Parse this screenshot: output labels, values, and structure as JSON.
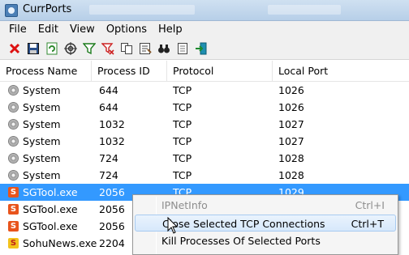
{
  "window": {
    "title": "CurrPorts"
  },
  "menu": [
    "File",
    "Edit",
    "View",
    "Options",
    "Help"
  ],
  "toolbar": [
    "close-connection-icon",
    "save-icon",
    "refresh-icon",
    "target-icon",
    "filter-icon",
    "clear-filter-icon",
    "copy-icon",
    "properties-icon",
    "find-icon",
    "report-icon",
    "exit-icon"
  ],
  "columns": [
    "Process Name",
    "Process ID",
    "Protocol",
    "Local Port"
  ],
  "rows": [
    {
      "icon": "gear",
      "name": "System",
      "pid": "644",
      "protocol": "TCP",
      "port": "1026",
      "selected": false
    },
    {
      "icon": "gear",
      "name": "System",
      "pid": "644",
      "protocol": "TCP",
      "port": "1026",
      "selected": false
    },
    {
      "icon": "gear",
      "name": "System",
      "pid": "1032",
      "protocol": "TCP",
      "port": "1027",
      "selected": false
    },
    {
      "icon": "gear",
      "name": "System",
      "pid": "1032",
      "protocol": "TCP",
      "port": "1027",
      "selected": false
    },
    {
      "icon": "gear",
      "name": "System",
      "pid": "724",
      "protocol": "TCP",
      "port": "1028",
      "selected": false
    },
    {
      "icon": "gear",
      "name": "System",
      "pid": "724",
      "protocol": "TCP",
      "port": "1028",
      "selected": false
    },
    {
      "icon": "sgtool",
      "name": "SGTool.exe",
      "pid": "2056",
      "protocol": "TCP",
      "port": "1029",
      "selected": true
    },
    {
      "icon": "sgtool",
      "name": "SGTool.exe",
      "pid": "2056",
      "protocol": "",
      "port": "",
      "selected": false
    },
    {
      "icon": "sgtool",
      "name": "SGTool.exe",
      "pid": "2056",
      "protocol": "",
      "port": "",
      "selected": false
    },
    {
      "icon": "sohu",
      "name": "SohuNews.exe",
      "pid": "2204",
      "protocol": "",
      "port": "",
      "selected": false
    }
  ],
  "context_menu": [
    {
      "label": "IPNetInfo",
      "shortcut": "Ctrl+I",
      "state": "disabled"
    },
    {
      "label": "Close Selected TCP Connections",
      "shortcut": "Ctrl+T",
      "state": "hover"
    },
    {
      "label": "Kill Processes Of Selected Ports",
      "shortcut": "",
      "state": "normal"
    }
  ]
}
